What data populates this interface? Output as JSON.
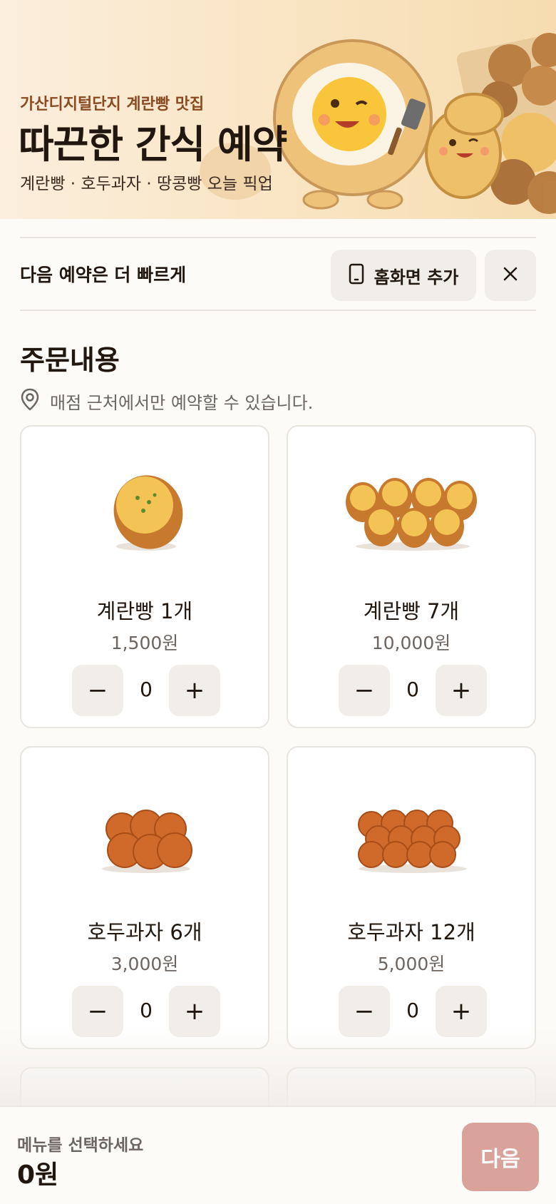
{
  "hero": {
    "subtitle": "가산디지털단지 계란빵 맛집",
    "title": "따끈한 간식 예약",
    "description": "계란빵 · 호두과자 · 땅콩빵 오늘 픽업"
  },
  "install": {
    "label": "다음 예약은 더 빠르게",
    "button_label": "홈화면 추가",
    "close_icon": "close-icon",
    "phone_icon": "phone-icon"
  },
  "order": {
    "title": "주문내용",
    "notice": "매점 근처에서만 예약할 수 있습니다."
  },
  "products": [
    {
      "name": "계란빵 1개",
      "price": "1,500원",
      "qty": "0",
      "image": "egg-bread-single"
    },
    {
      "name": "계란빵 7개",
      "price": "10,000원",
      "qty": "0",
      "image": "egg-bread-set"
    },
    {
      "name": "호두과자 6개",
      "price": "3,000원",
      "qty": "0",
      "image": "walnut-cake-6"
    },
    {
      "name": "호두과자 12개",
      "price": "5,000원",
      "qty": "0",
      "image": "walnut-cake-12"
    }
  ],
  "controls": {
    "minus": "−",
    "plus": "+"
  },
  "footer": {
    "label": "메뉴를 선택하세요",
    "total": "0원",
    "next_label": "다음"
  },
  "colors": {
    "accent": "#8a4a22",
    "next_button": "#d9a29a",
    "control_bg": "#f1ede8"
  }
}
